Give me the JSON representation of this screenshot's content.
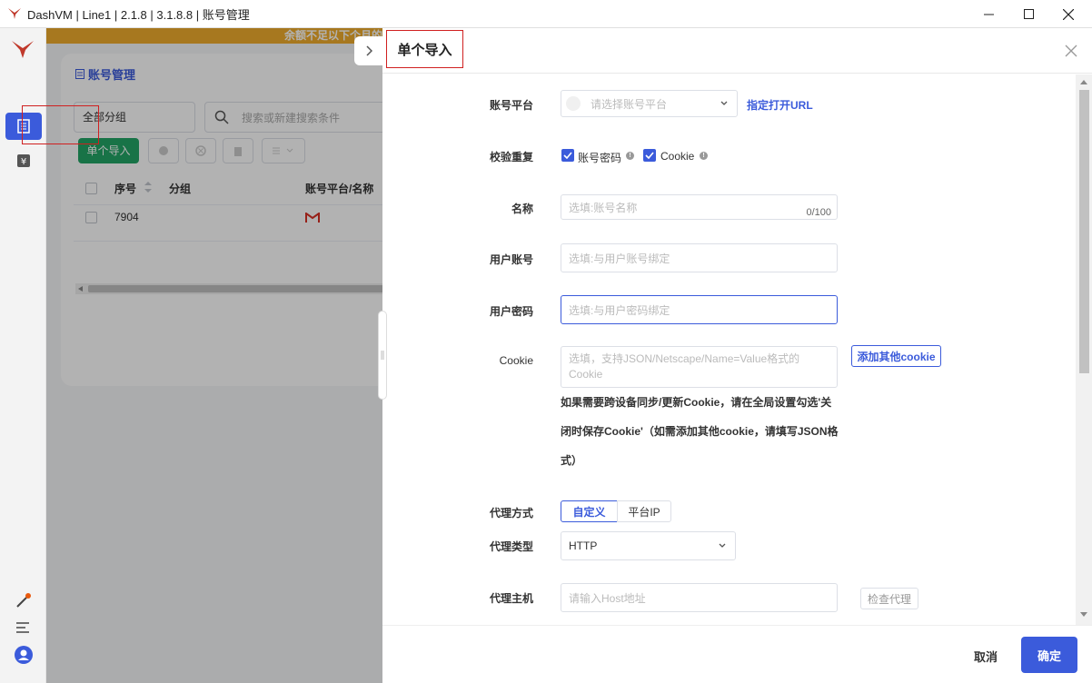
{
  "window": {
    "title": "DashVM | Line1 | 2.1.8 | 3.1.8.8 | 账号管理",
    "minimize_icon": "minimize-icon",
    "maximize_icon": "maximize-icon",
    "close_icon": "close-icon"
  },
  "background": {
    "banner_text": "余额不足以下个月的",
    "card_title": "账号管理",
    "group_select": "全部分组",
    "search_placeholder": "搜索或新建搜索条件",
    "import_button": "单个导入",
    "table": {
      "headers": [
        "序号",
        "分组",
        "账号平台/名称"
      ],
      "rows": [
        {
          "index": "7904",
          "group": "",
          "platform_icon": "gmail-icon"
        }
      ]
    }
  },
  "drawer": {
    "title": "单个导入",
    "platform": {
      "label": "账号平台",
      "placeholder": "请选择账号平台",
      "link": "指定打开URL"
    },
    "dedupe": {
      "label": "校验重复",
      "opt1": "账号密码",
      "opt2": "Cookie"
    },
    "name": {
      "label": "名称",
      "placeholder": "选填:账号名称",
      "counter": "0/100"
    },
    "user_account": {
      "label": "用户账号",
      "placeholder": "选填:与用户账号绑定"
    },
    "user_password": {
      "label": "用户密码",
      "placeholder": "选填:与用户密码绑定"
    },
    "cookie": {
      "label": "Cookie",
      "placeholder": "选填，支持JSON/Netscape/Name=Value格式的Cookie",
      "add_button": "添加其他cookie",
      "hint_line1": "如果需要跨设备同步/更新Cookie，请在全局设置勾选'关",
      "hint_line2": "闭时保存Cookie'（如需添加其他cookie，请填写JSON格",
      "hint_line3": "式）"
    },
    "proxy_mode": {
      "label": "代理方式",
      "options": [
        "自定义",
        "平台IP"
      ],
      "selected": "自定义"
    },
    "proxy_type": {
      "label": "代理类型",
      "value": "HTTP"
    },
    "proxy_host": {
      "label": "代理主机",
      "placeholder": "请输入Host地址",
      "check_button": "检查代理"
    },
    "footer": {
      "cancel": "取消",
      "confirm": "确定"
    }
  },
  "colors": {
    "primary": "#3b5bdb",
    "success": "#23a566",
    "warning": "#f0ad2d",
    "highlight": "#d02020"
  }
}
